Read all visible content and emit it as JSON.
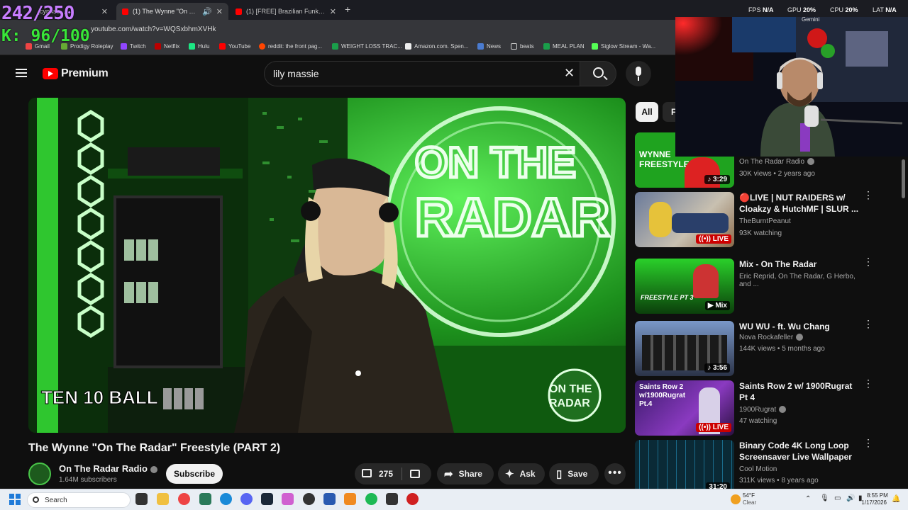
{
  "browser": {
    "tabs": [
      {
        "label": "jcyn4sb...",
        "active": false
      },
      {
        "label": "(1) The Wynne \"On The Rad",
        "active": true
      },
      {
        "label": "(1) [FREE] Brazilian Funk x Club",
        "active": false
      }
    ],
    "new_tab": "+",
    "url": "youtube.com/watch?v=WQSxbhmXVHk",
    "bookmarks": [
      "Gmail",
      "Prodigy Roleplay",
      "Twitch",
      "Netflix",
      "Hulu",
      "YouTube",
      "reddit: the front pag...",
      "WEIGHT LOSS TRAC...",
      "Amazon.com. Spen...",
      "News",
      "beats",
      "MEAL PLAN",
      "Siglow Stream - Wa..."
    ]
  },
  "overlay": {
    "counter_top": "242/250",
    "counter_k": "K: 96/100",
    "fps_label": "FPS",
    "fps_value": "N/A",
    "gpu_label": "GPU",
    "gpu_value": "20%",
    "cpu_label": "CPU",
    "cpu_value": "20%",
    "lat_label": "LAT",
    "lat_value": "N/A",
    "gemini": "Gemini"
  },
  "youtube": {
    "logo_text": "Premium",
    "search_value": "lily massie",
    "search_placeholder": "Search"
  },
  "video": {
    "title": "The Wynne \"On The Radar\" Freestyle (PART 2)",
    "channel": "On The Radar Radio",
    "subscribers": "1.64M subscribers",
    "subscribe_label": "Subscribe",
    "likes": "275",
    "share_label": "Share",
    "ask_label": "Ask",
    "save_label": "Save",
    "scene_text": {
      "neon_line1": "ON THE",
      "neon_line2": "RADAR",
      "sponsor": "TEN 10 BALL",
      "corner_logo1": "ON THE",
      "corner_logo2": "RADAR"
    }
  },
  "chips": [
    "All",
    "F"
  ],
  "related": [
    {
      "title": "",
      "channel": "On The Radar Radio",
      "verified": true,
      "meta": "30K views • 2 years ago",
      "badge": "3:29",
      "badge_type": "duration",
      "thumb_text": "WYNNE FREESTYLE",
      "thumb_color": "#1fa31f"
    },
    {
      "title": "🔴LIVE | NUT RAIDERS w/ Cloakzy & HutchMF | SLUR ...",
      "channel": "TheBurntPeanut",
      "verified": false,
      "meta": "93K watching",
      "badge": "LIVE",
      "badge_type": "live",
      "thumb_text": "",
      "thumb_color": "#8a8fa3"
    },
    {
      "title": "Mix - On The Radar",
      "channel": "Eric Reprid, On The Radar, G Herbo, and ...",
      "verified": false,
      "meta": "",
      "badge": "Mix",
      "badge_type": "mix",
      "thumb_text": "FREESTYLE PT 3",
      "thumb_color": "#1a7a1a"
    },
    {
      "title": "WU WU - ft. Wu Chang",
      "channel": "Nova Rockafeller",
      "verified": true,
      "meta": "144K views • 5 months ago",
      "badge": "3:56",
      "badge_type": "duration",
      "thumb_text": "",
      "thumb_color": "#3b4a66"
    },
    {
      "title": "Saints Row 2 w/ 1900Rugrat Pt 4",
      "channel": "1900Rugrat",
      "verified": true,
      "meta": "47 watching",
      "badge": "LIVE",
      "badge_type": "live",
      "thumb_text": "Saints Row 2 w/1900Rugrat Pt.4",
      "thumb_color": "#5a2a8a"
    },
    {
      "title": "Binary Code 4K Long Loop Screensaver Live Wallpaper",
      "channel": "Cool Motion",
      "verified": false,
      "meta": "311K views • 8 years ago",
      "badge": "31:20",
      "badge_type": "duration",
      "thumb_text": "",
      "thumb_color": "#0a2a36"
    }
  ],
  "taskbar": {
    "search_label": "Search",
    "weather_temp": "54°F",
    "weather_desc": "Clear",
    "time": "8:55 PM",
    "date": "1/17/2026"
  }
}
